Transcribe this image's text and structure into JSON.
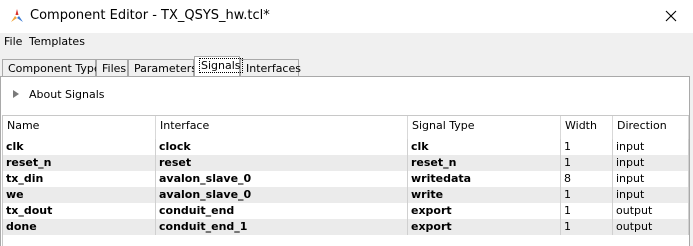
{
  "window": {
    "title": "Component Editor - TX_QSYS_hw.tcl*",
    "icon": "component-editor-icon",
    "close_icon": "close-icon"
  },
  "menu": {
    "items": [
      {
        "label": "File"
      },
      {
        "label": "Templates"
      }
    ]
  },
  "tabs": [
    {
      "label": "Component Type"
    },
    {
      "label": "Files"
    },
    {
      "label": "Parameters"
    },
    {
      "label": "Signals",
      "active": true
    },
    {
      "label": "Interfaces"
    }
  ],
  "about": {
    "label": "About Signals",
    "icon": "expand-triangle-icon"
  },
  "table": {
    "columns": [
      "Name",
      "Interface",
      "Signal Type",
      "Width",
      "Direction"
    ],
    "rows": [
      [
        "clk",
        "clock",
        "clk",
        "1",
        "input"
      ],
      [
        "reset_n",
        "reset",
        "reset_n",
        "1",
        "input"
      ],
      [
        "tx_din",
        "avalon_slave_0",
        "writedata",
        "8",
        "input"
      ],
      [
        "we",
        "avalon_slave_0",
        "write",
        "1",
        "input"
      ],
      [
        "tx_dout",
        "conduit_end",
        "export",
        "1",
        "output"
      ],
      [
        "done",
        "conduit_end_1",
        "export",
        "1",
        "output"
      ]
    ]
  },
  "colors": {
    "row_alt": "#ebebeb",
    "icon_red": "#d9322d",
    "icon_orange": "#f2a53a",
    "icon_blue": "#3b7bd4"
  }
}
